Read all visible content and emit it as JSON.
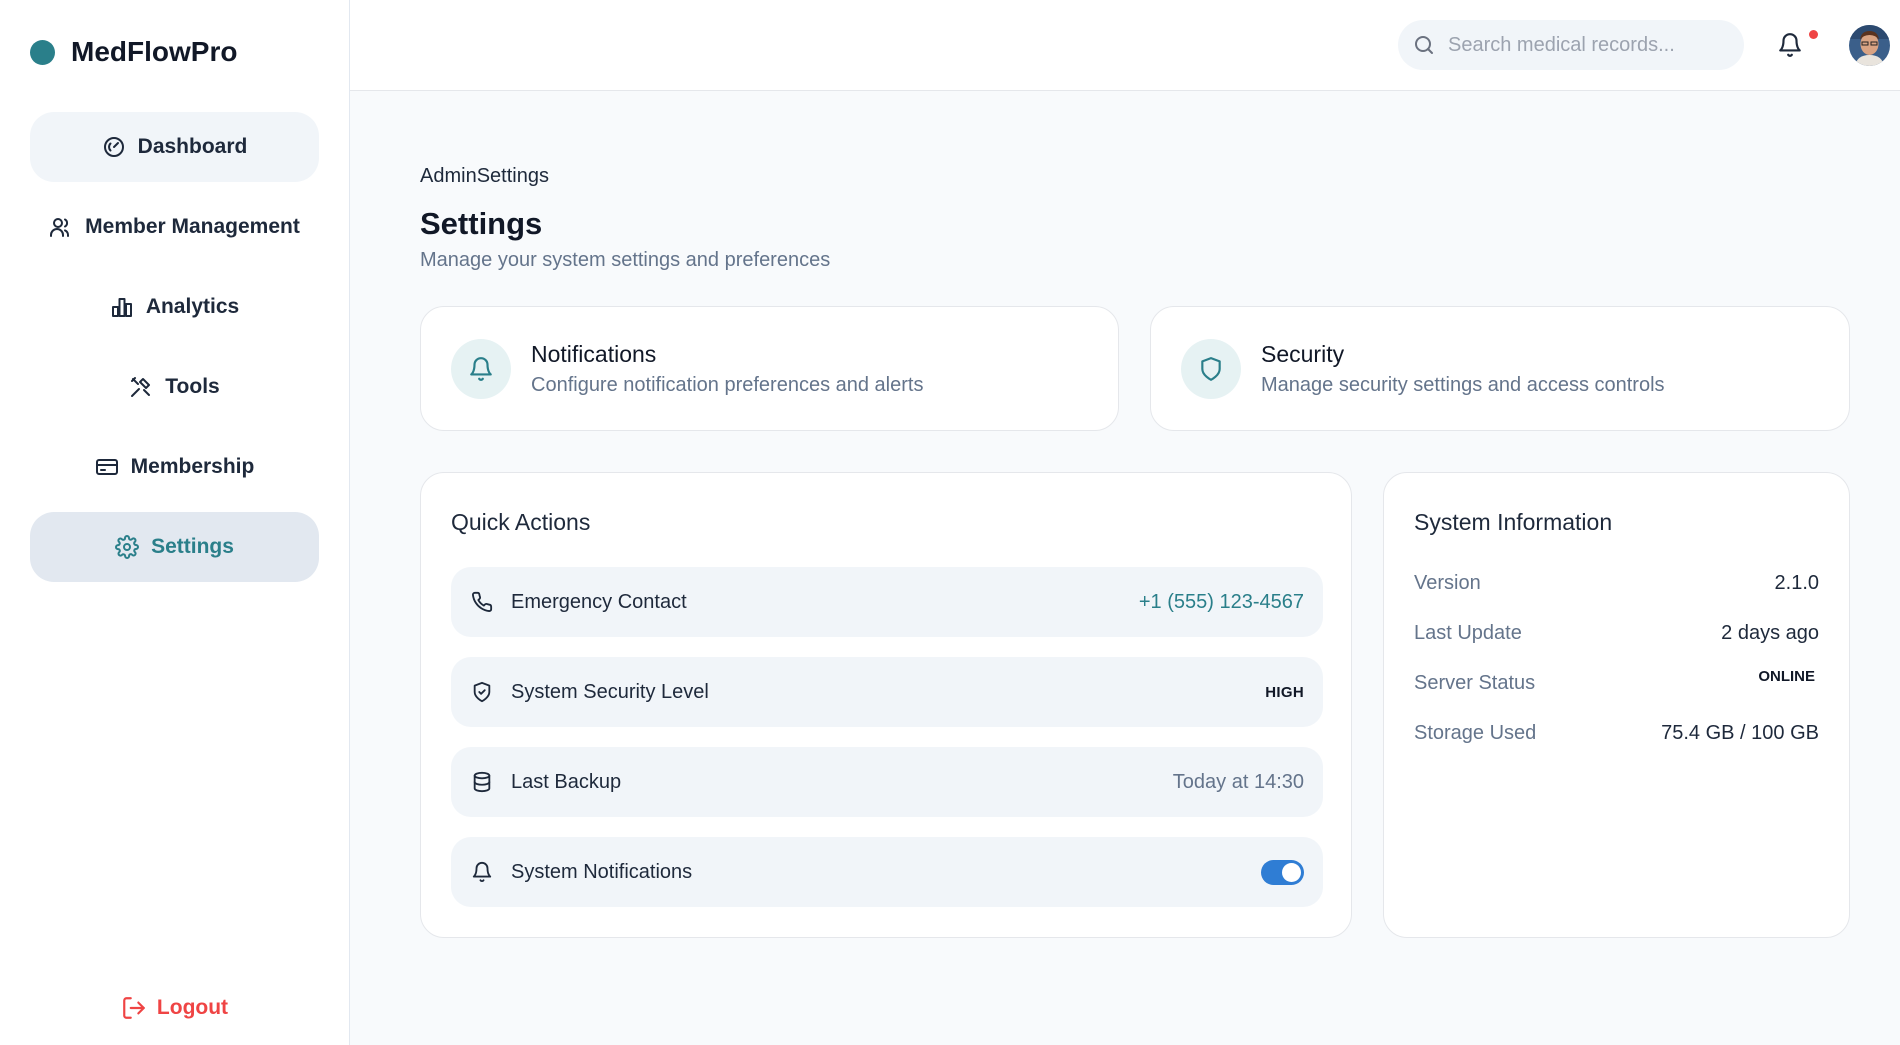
{
  "app": {
    "name": "MedFlowPro",
    "brand_color": "#2a7f8a"
  },
  "sidebar": {
    "items": [
      {
        "label": "Dashboard",
        "icon": "gauge-icon"
      },
      {
        "label": "Member Management",
        "icon": "users-icon"
      },
      {
        "label": "Analytics",
        "icon": "bar-chart-icon"
      },
      {
        "label": "Tools",
        "icon": "tools-icon"
      },
      {
        "label": "Membership",
        "icon": "card-icon"
      },
      {
        "label": "Settings",
        "icon": "gear-icon",
        "active": true
      }
    ],
    "logout_label": "Logout"
  },
  "topbar": {
    "search_placeholder": "Search medical records...",
    "has_unread_notifications": true
  },
  "page": {
    "breadcrumb": "AdminSettings",
    "title": "Settings",
    "subtitle": "Manage your system settings and preferences"
  },
  "feature_cards": [
    {
      "title": "Notifications",
      "description": "Configure notification preferences and alerts",
      "icon": "bell-icon"
    },
    {
      "title": "Security",
      "description": "Manage security settings and access controls",
      "icon": "shield-icon"
    }
  ],
  "quick_actions": {
    "title": "Quick Actions",
    "items": [
      {
        "label": "Emergency Contact",
        "value": "+1 (555) 123-4567",
        "icon": "phone-icon"
      },
      {
        "label": "System Security Level",
        "value": "HIGH",
        "icon": "shield-icon"
      },
      {
        "label": "Last Backup",
        "value": "Today at 14:30",
        "icon": "database-icon"
      },
      {
        "label": "System Notifications",
        "toggle_on": true,
        "icon": "bell-icon"
      }
    ]
  },
  "system_info": {
    "title": "System Information",
    "rows": [
      {
        "key": "Version",
        "value": "2.1.0"
      },
      {
        "key": "Last Update",
        "value": "2 days ago"
      },
      {
        "key": "Server Status",
        "value": "ONLINE"
      },
      {
        "key": "Storage Used",
        "value": "75.4 GB / 100 GB"
      }
    ]
  }
}
